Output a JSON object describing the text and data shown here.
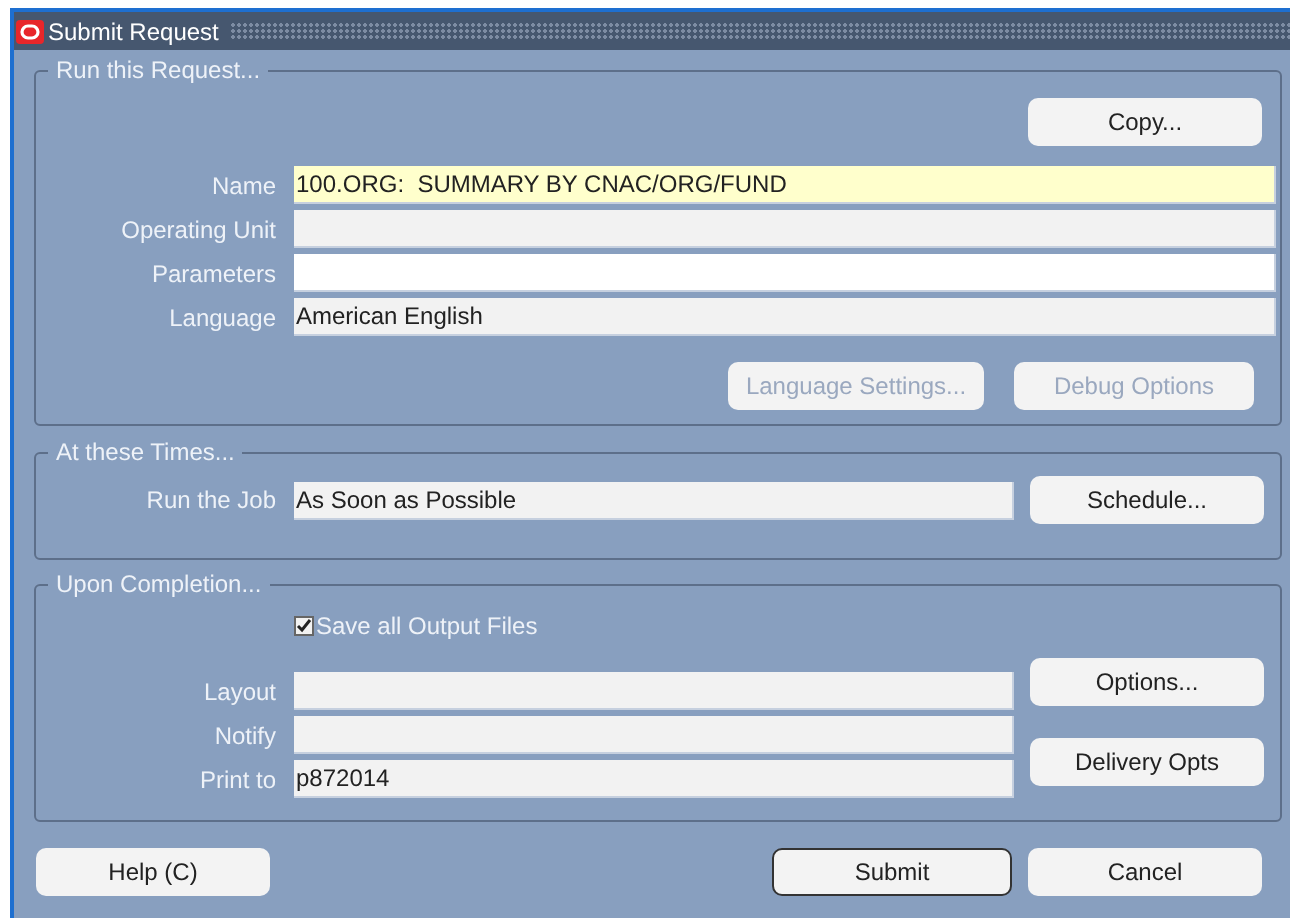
{
  "window": {
    "title": "Submit Request"
  },
  "run_request": {
    "legend": "Run this Request...",
    "copy_button": {
      "label": "Copy...",
      "disabled": false
    },
    "fields": [
      {
        "label": "Name",
        "value": "100.ORG:  SUMMARY BY CNAC/ORG/FUND",
        "kind": "required"
      },
      {
        "label": "Operating Unit",
        "kind": "readonly"
      },
      {
        "label": "Parameters",
        "kind": "editable"
      },
      {
        "label": "Language",
        "value": "American English",
        "kind": "readonly"
      }
    ],
    "buttons": [
      {
        "label": "Language Settings...",
        "disabled": true
      },
      {
        "label": "Debug Options",
        "disabled": true
      }
    ]
  },
  "schedule": {
    "legend": "At these Times...",
    "field": {
      "label": "Run the Job",
      "value": "As Soon as Possible",
      "kind": "readonly"
    },
    "button": {
      "label": "Schedule...",
      "disabled": false
    }
  },
  "completion": {
    "legend": "Upon Completion...",
    "save_output": {
      "label": "Save all Output Files",
      "checked": true
    },
    "fields": [
      {
        "label": "Layout",
        "kind": "readonly"
      },
      {
        "label": "Notify",
        "kind": "readonly"
      },
      {
        "label": "Print to",
        "value": "p872014",
        "kind": "readonly"
      }
    ],
    "buttons": [
      {
        "label": "Options...",
        "disabled": false
      },
      {
        "label": "Delivery Opts",
        "disabled": false
      }
    ]
  },
  "footer_buttons": [
    {
      "label": "Help (C)",
      "default": false
    },
    {
      "label": "Submit",
      "default": true
    },
    {
      "label": "Cancel",
      "default": false
    }
  ]
}
